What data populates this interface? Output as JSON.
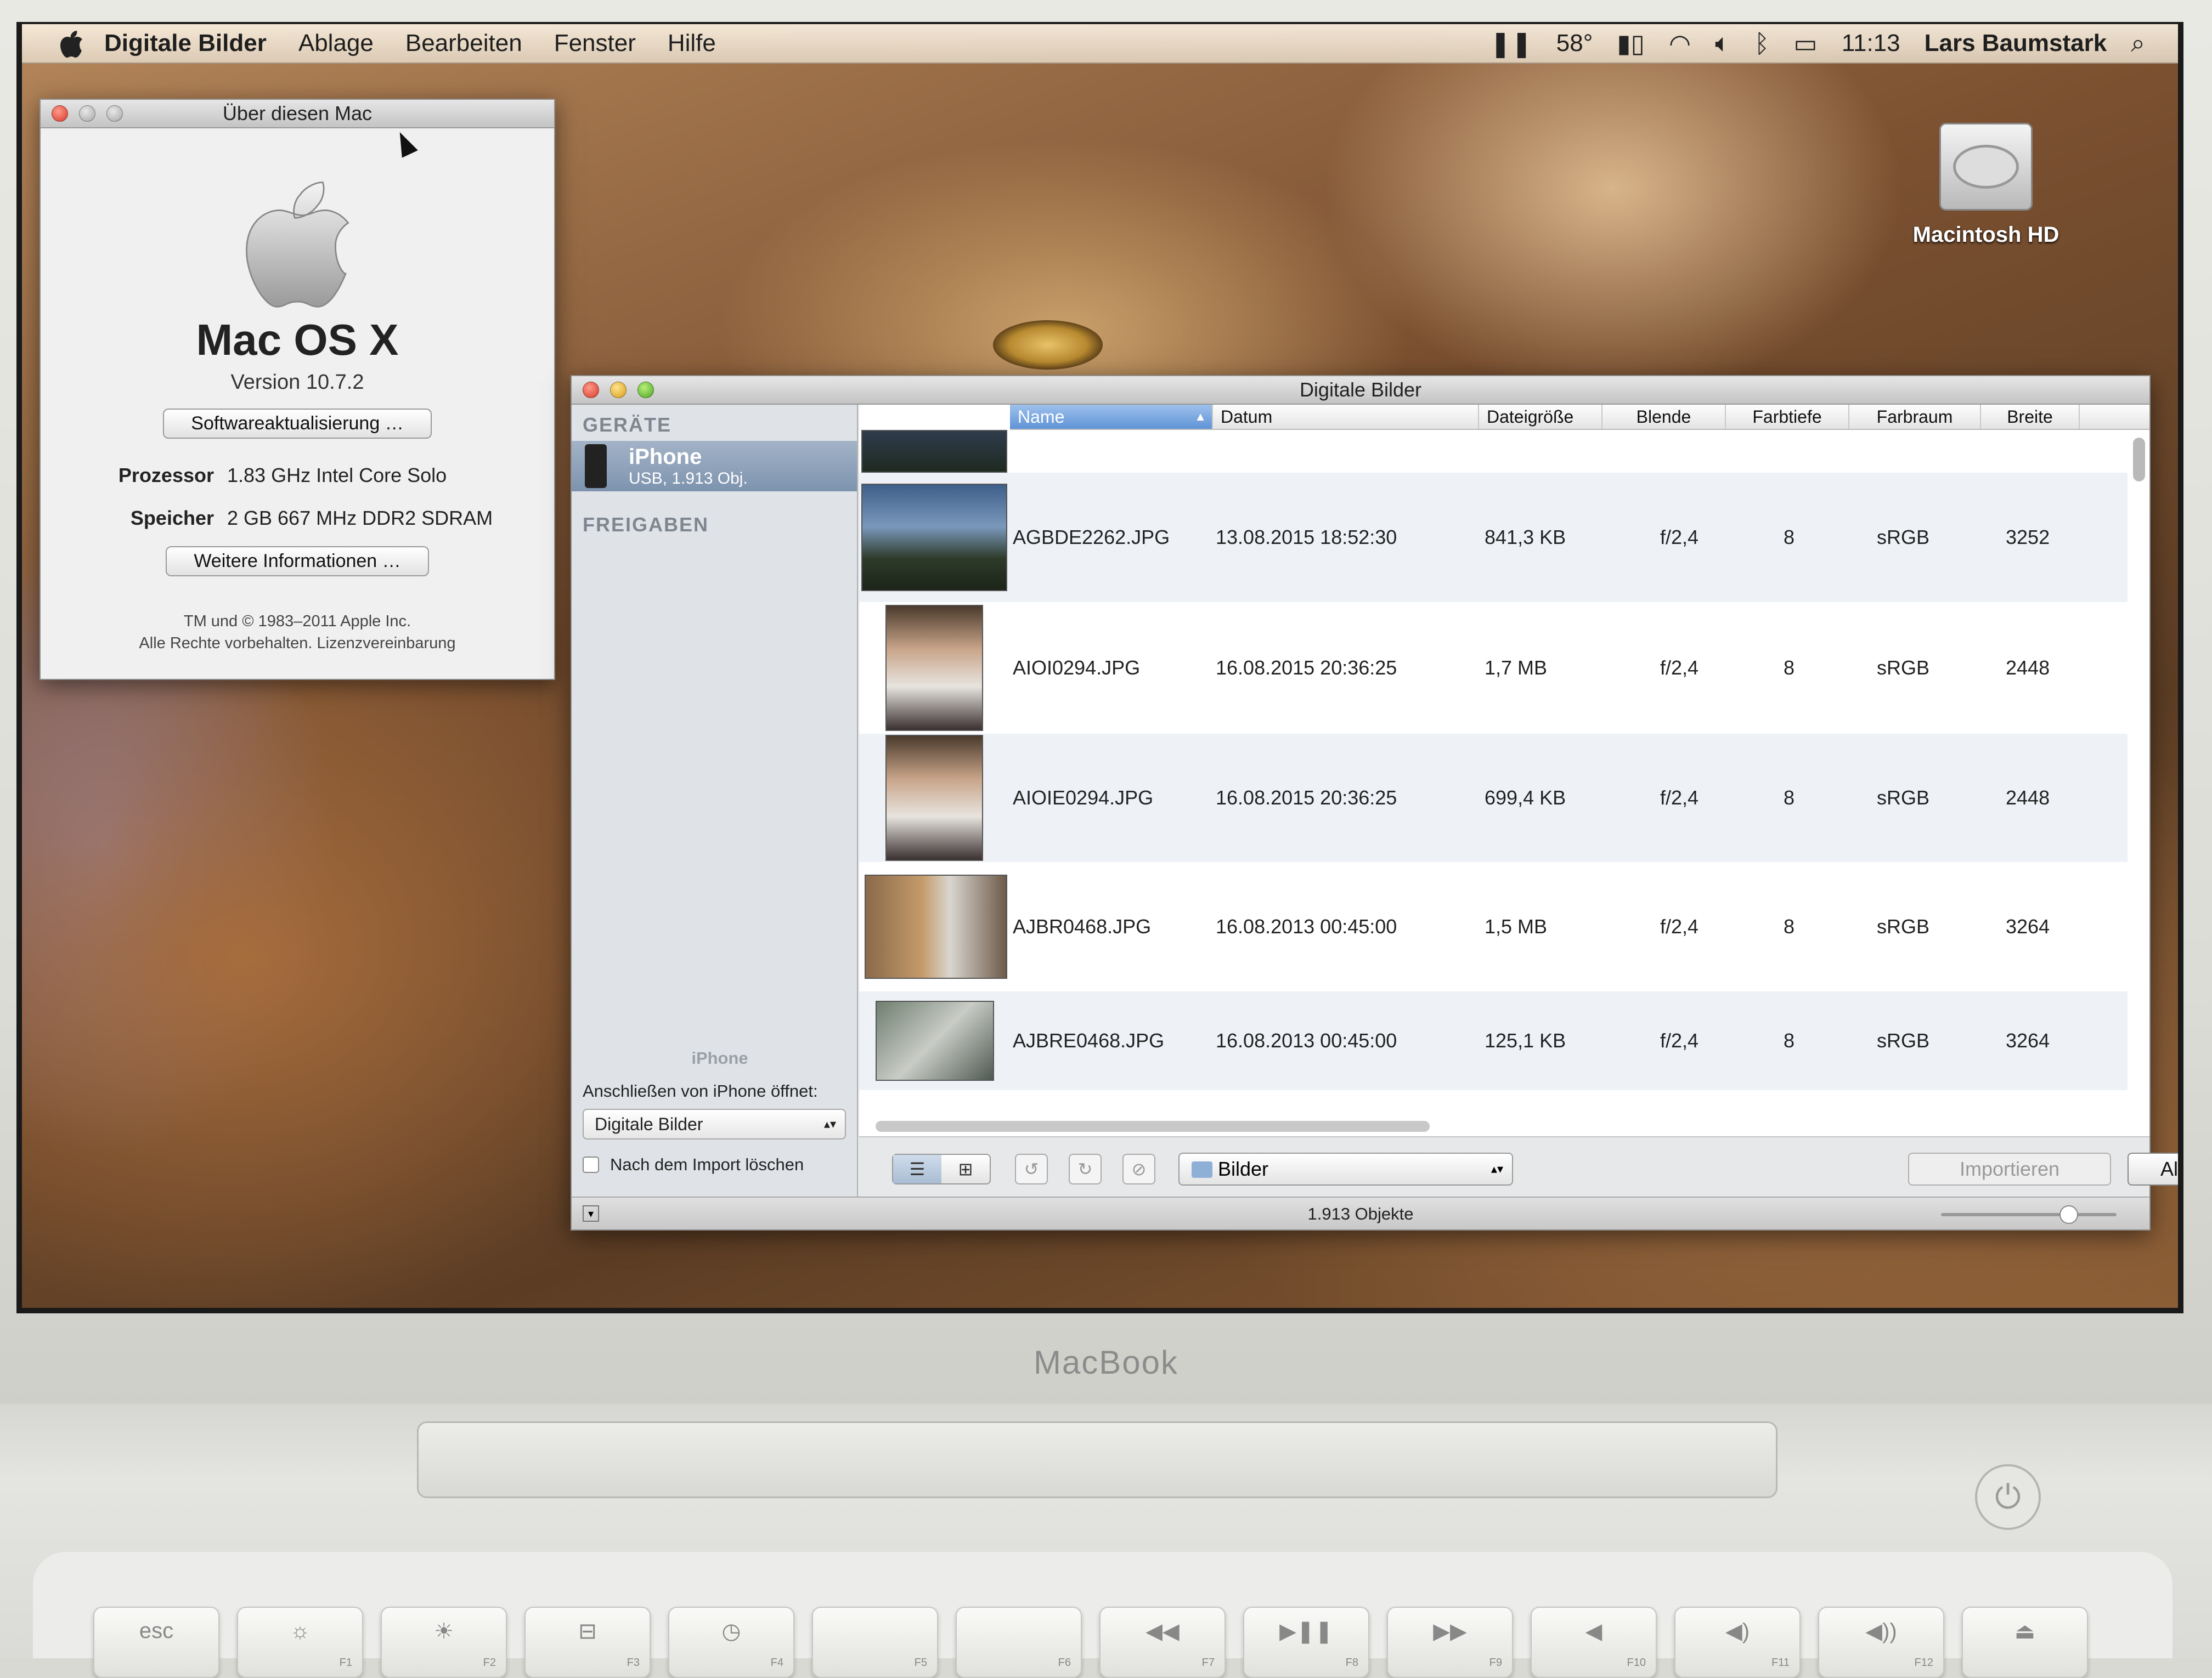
{
  "menubar": {
    "app_name": "Digitale Bilder",
    "items": [
      "Ablage",
      "Bearbeiten",
      "Fenster",
      "Hilfe"
    ],
    "temp": "58°",
    "clock": "11:13",
    "user": "Lars Baumstark"
  },
  "desktop": {
    "hd_label": "Macintosh HD"
  },
  "about": {
    "title": "Über diesen Mac",
    "os_name": "Mac OS X",
    "version": "Version 10.7.2",
    "update_button": "Softwareaktualisierung …",
    "processor_label": "Prozessor",
    "processor_value": "1.83 GHz Intel Core Solo",
    "memory_label": "Speicher",
    "memory_value": "2 GB 667 MHz  DDR2 SDRAM",
    "more_button": "Weitere Informationen …",
    "legal1": "TM und © 1983–2011 Apple Inc.",
    "legal2": "Alle Rechte vorbehalten.  Lizenzvereinbarung"
  },
  "images": {
    "title": "Digitale Bilder",
    "devices_header": "GERÄTE",
    "device_name": "iPhone",
    "device_sub": "USB, 1.913 Obj.",
    "shares_header": "FREIGABEN",
    "bottom_device": "iPhone",
    "connect_label": "Anschließen von iPhone öffnet:",
    "connect_app": "Digitale Bilder",
    "delete_after": "Nach dem Import löschen",
    "columns": [
      "Name",
      "Datum",
      "Dateigröße",
      "Blende",
      "Farbtiefe",
      "Farbraum",
      "Breite"
    ],
    "rows": [
      {
        "name": "AGBDE2262.JPG",
        "date": "13.08.2015 18:52:30",
        "size": "841,3 KB",
        "aperture": "f/2,4",
        "depth": "8",
        "space": "sRGB",
        "width": "3252"
      },
      {
        "name": "AIOI0294.JPG",
        "date": "16.08.2015 20:36:25",
        "size": "1,7 MB",
        "aperture": "f/2,4",
        "depth": "8",
        "space": "sRGB",
        "width": "2448"
      },
      {
        "name": "AIOIE0294.JPG",
        "date": "16.08.2015 20:36:25",
        "size": "699,4 KB",
        "aperture": "f/2,4",
        "depth": "8",
        "space": "sRGB",
        "width": "2448"
      },
      {
        "name": "AJBR0468.JPG",
        "date": "16.08.2013 00:45:00",
        "size": "1,5 MB",
        "aperture": "f/2,4",
        "depth": "8",
        "space": "sRGB",
        "width": "3264"
      },
      {
        "name": "AJBRE0468.JPG",
        "date": "16.08.2013 00:45:00",
        "size": "125,1 KB",
        "aperture": "f/2,4",
        "depth": "8",
        "space": "sRGB",
        "width": "3264"
      }
    ],
    "destination": "Bilder",
    "import_button": "Importieren",
    "import_all_button": "Alle importieren",
    "count": "1.913 Objekte",
    "thumb_size": 0.72
  },
  "laptop": {
    "brand": "MacBook",
    "keys": [
      "esc",
      "F1",
      "F2",
      "F3",
      "F4",
      "F5",
      "F6",
      "F7",
      "F8",
      "F9",
      "F10",
      "F11",
      "F12"
    ]
  }
}
